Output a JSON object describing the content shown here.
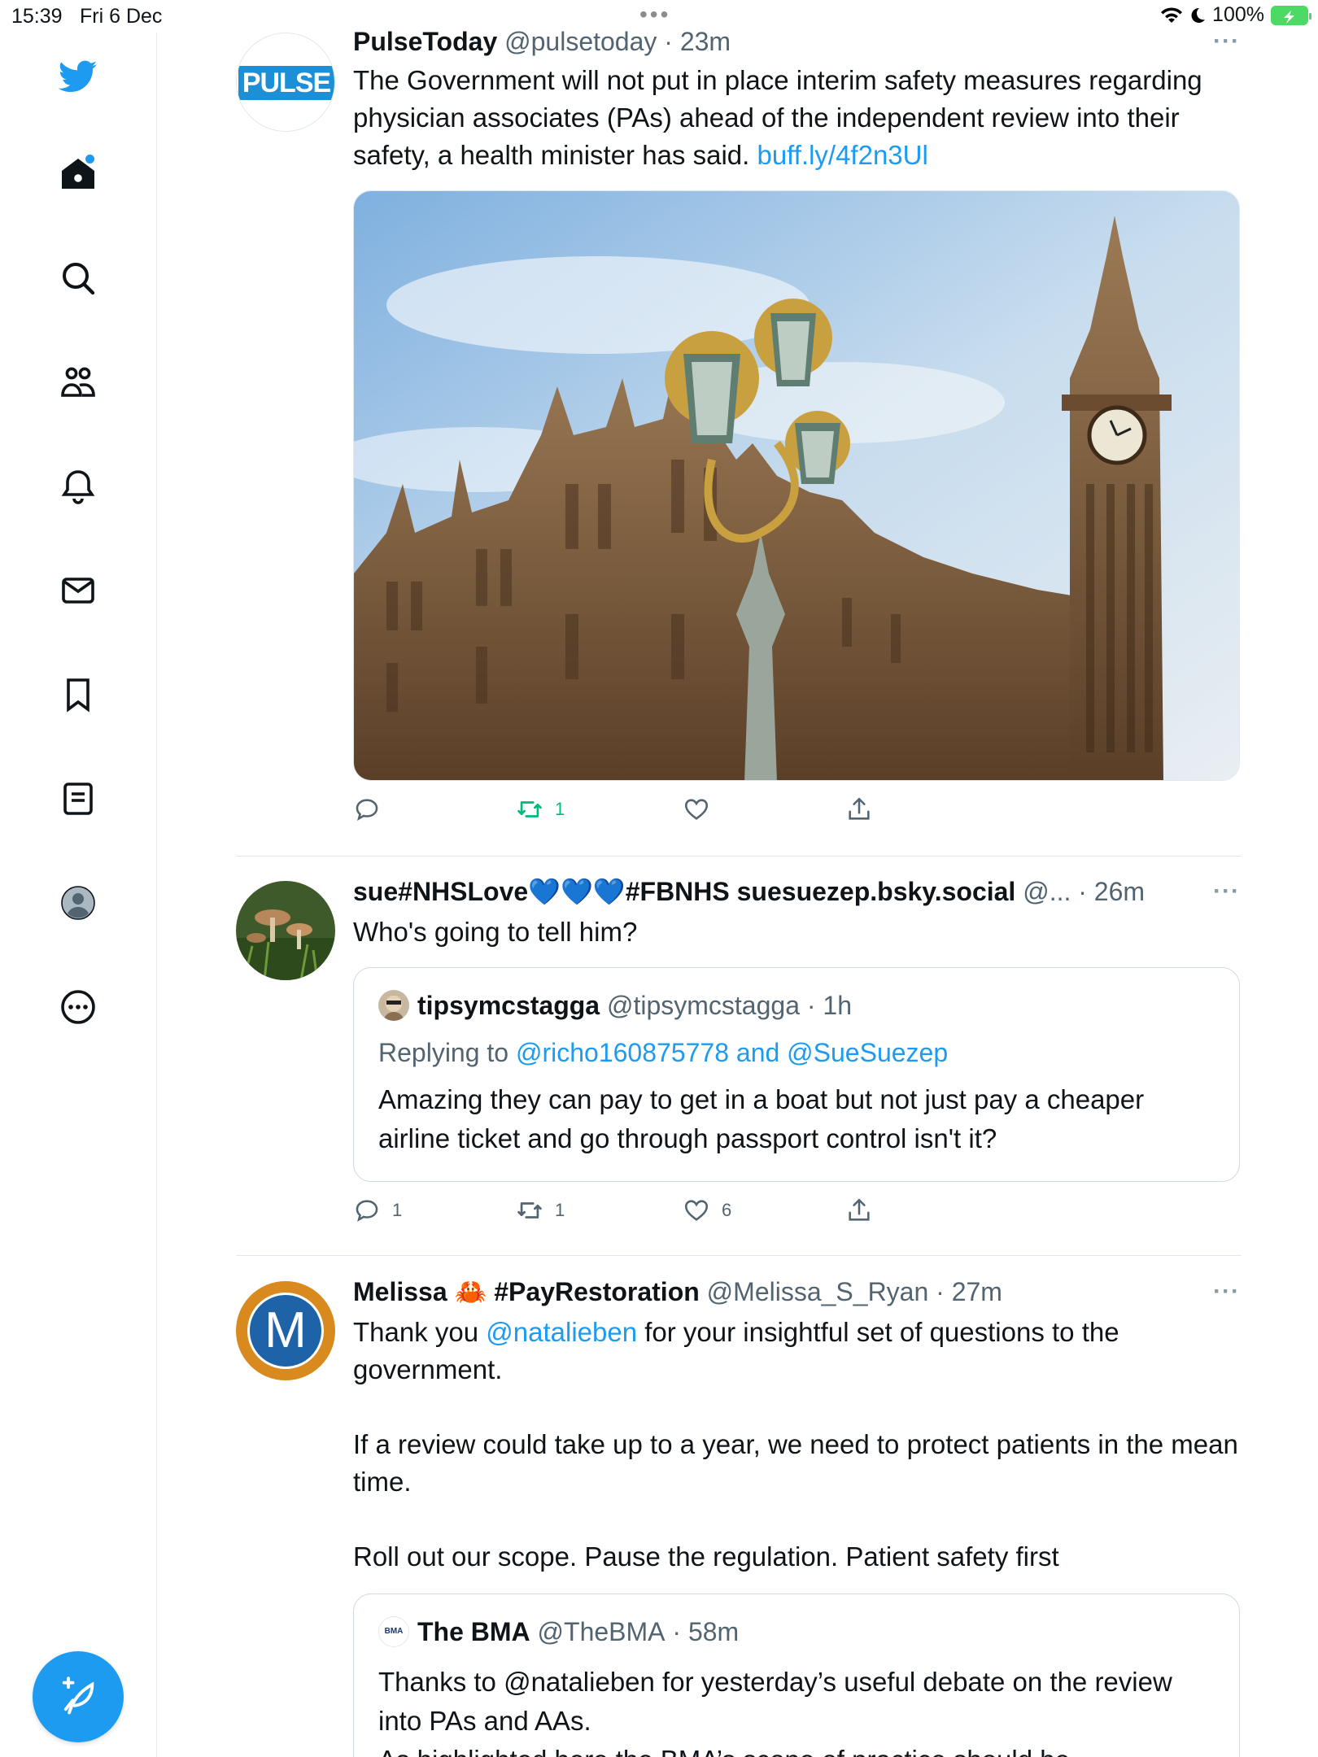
{
  "status_bar": {
    "time": "15:39",
    "date": "Fri 6 Dec",
    "dots": "•••",
    "battery": "100%"
  },
  "sidebar": {
    "items": [
      {
        "name": "twitter-logo",
        "icon": "twitter-bird-icon"
      },
      {
        "name": "home",
        "icon": "home-icon"
      },
      {
        "name": "explore",
        "icon": "search-icon"
      },
      {
        "name": "communities",
        "icon": "people-icon"
      },
      {
        "name": "notifications",
        "icon": "bell-icon"
      },
      {
        "name": "messages",
        "icon": "envelope-icon"
      },
      {
        "name": "bookmarks",
        "icon": "bookmark-icon"
      },
      {
        "name": "lists",
        "icon": "list-icon"
      },
      {
        "name": "profile",
        "icon": "profile-icon"
      },
      {
        "name": "more",
        "icon": "more-circle-icon"
      }
    ],
    "compose_icon": "feather-plus-icon"
  },
  "colors": {
    "accent": "#1d9bf0",
    "retweet_green": "#00ba7c",
    "muted": "#536471"
  },
  "tweets": [
    {
      "name": "PulseToday",
      "handle": "@pulsetoday",
      "time": "23m",
      "avatar_text": "PULSE",
      "text": "The Government will not put in place interim safety measures regarding physician associates (PAs) ahead of the independent review into their safety, a health minister has said. ",
      "link": "buff.ly/4f2n3Ul",
      "actions": {
        "reply": "",
        "retweet": "1",
        "like": "",
        "share": ""
      }
    },
    {
      "name": "sue#NHSLove💙💙💙#FBNHS suesuezep.bsky.social",
      "handle": "@...",
      "time": "26m",
      "text": "Who's going to tell him?",
      "quote": {
        "name": "tipsymcstagga",
        "handle": "@tipsymcstagga",
        "time": "1h",
        "replying_prefix": "Replying to ",
        "replying_to": "@richo160875778 and @SueSuezep",
        "text": "Amazing they can pay to get in a boat but not just pay a cheaper airline ticket and go through passport control isn't it?"
      },
      "actions": {
        "reply": "1",
        "retweet": "1",
        "like": "6",
        "share": ""
      }
    },
    {
      "name": "Melissa 🦀 #PayRestoration",
      "handle": "@Melissa_S_Ryan",
      "time": "27m",
      "avatar_letter": "M",
      "text_pre": "Thank you ",
      "mention": "@natalieben",
      "text_post": " for your insightful set of questions to the government.",
      "paragraph2": "If a review could take up to a year, we need to protect patients in the mean time.",
      "paragraph3": "Roll out our scope. Pause the regulation. Patient safety first",
      "quote": {
        "name": "The BMA",
        "handle": "@TheBMA",
        "time": "58m",
        "avatar_text": "BMA",
        "text": "Thanks to @natalieben for yesterday’s useful debate on the review into PAs and AAs.",
        "text_cut": "As highlighted here the BMA’s scope of practice should be"
      }
    }
  ]
}
